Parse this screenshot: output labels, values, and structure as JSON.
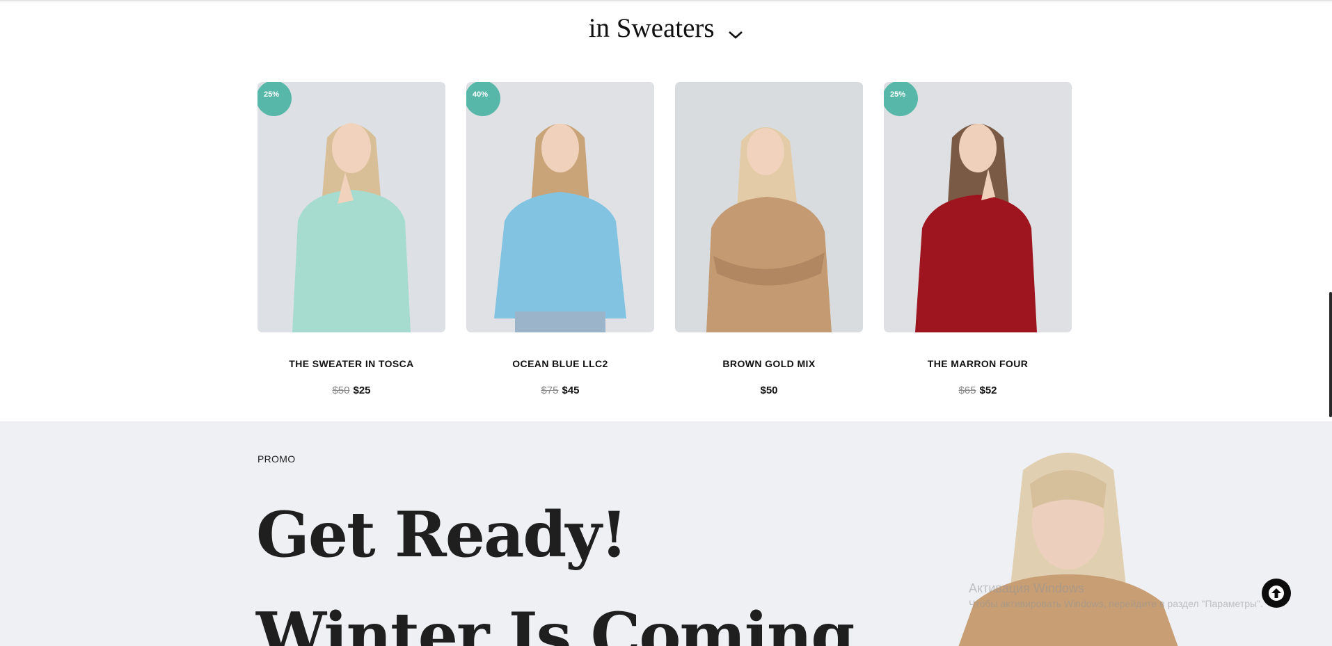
{
  "header": {
    "title": "in Sweaters",
    "chevron_icon": "chevron-down-icon"
  },
  "products": [
    {
      "name": "THE SWEATER IN TOSCA",
      "badge": "25%",
      "old_price": "$50",
      "price": "$25",
      "sweater_color": "#a6dccf"
    },
    {
      "name": "OCEAN BLUE LLC2",
      "badge": "40%",
      "old_price": "$75",
      "price": "$45",
      "sweater_color": "#82c3e2"
    },
    {
      "name": "BROWN GOLD MIX",
      "badge": "",
      "old_price": "",
      "price": "$50",
      "sweater_color": "#c39a72"
    },
    {
      "name": "THE MARRON FOUR",
      "badge": "25%",
      "old_price": "$65",
      "price": "$52",
      "sweater_color": "#9e1520"
    }
  ],
  "promo": {
    "label": "PROMO",
    "headline_1": "Get Ready!",
    "headline_2": "Winter Is Coming"
  },
  "watermark": {
    "line1": "Активация Windows",
    "line2": "Чтобы активировать Windows, перейдите в раздел \"Параметры\"."
  },
  "scroll_top": {
    "icon": "arrow-up-icon"
  },
  "colors": {
    "badge": "#57b8a9",
    "promo_bg": "#eff0f3",
    "text": "#111111"
  }
}
